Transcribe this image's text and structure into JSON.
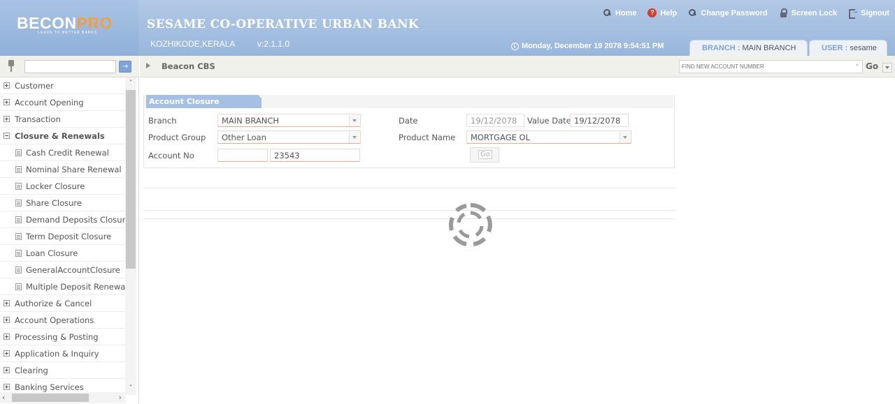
{
  "header": {
    "logo_text_a": "BE",
    "logo_text_b": "CON",
    "logo_text_c": "PRO",
    "logo_tagline": "LEADS TO BETTER BANKS",
    "bank_name": "SESAME CO-OPERATIVE URBAN BANK",
    "location": "KOZHIKODE,KERALA",
    "version": "v:2.1.1.0",
    "links": {
      "home": "Home",
      "help": "Help",
      "change_password": "Change Password",
      "screen_lock": "Screen Lock",
      "signout": "Signout"
    },
    "datetime": "Monday, December 19 2078 9:54:51 PM",
    "branch_key": "BRANCH :",
    "branch_value": "MAIN BRANCH",
    "user_key": "USER :",
    "user_value": "sesame"
  },
  "sidebar": {
    "search_value": "",
    "go_glyph": "→",
    "menu": [
      {
        "label": "Customer",
        "type": "collapsed"
      },
      {
        "label": "Account Opening",
        "type": "collapsed"
      },
      {
        "label": "Transaction",
        "type": "collapsed"
      },
      {
        "label": "Closure & Renewals",
        "type": "expanded"
      },
      {
        "label": "Cash Credit Renewal",
        "type": "child"
      },
      {
        "label": "Nominal Share Renewal",
        "type": "child"
      },
      {
        "label": "Locker Closure",
        "type": "child"
      },
      {
        "label": "Share Closure",
        "type": "child"
      },
      {
        "label": "Demand Deposits Closure",
        "type": "child"
      },
      {
        "label": "Term Deposit Closure",
        "type": "child"
      },
      {
        "label": "Loan Closure",
        "type": "child"
      },
      {
        "label": "GeneralAccountClosure",
        "type": "child"
      },
      {
        "label": "Multiple Deposit Renewal",
        "type": "child"
      },
      {
        "label": "Authorize & Cancel",
        "type": "collapsed"
      },
      {
        "label": "Account Operations",
        "type": "collapsed"
      },
      {
        "label": "Processing & Posting",
        "type": "collapsed"
      },
      {
        "label": "Application & Inquiry",
        "type": "collapsed"
      },
      {
        "label": "Clearing",
        "type": "collapsed"
      },
      {
        "label": "Banking Services",
        "type": "collapsed"
      }
    ],
    "scroll_up": "˄",
    "scroll_down": "˅",
    "scroll_left": "‹",
    "scroll_right": "›"
  },
  "main": {
    "breadcrumb": "Beacon CBS",
    "account_search_placeholder": "FIND NEW ACCOUNT NUMBER",
    "account_search_go": "Go",
    "panel_title": "Account Closure",
    "form": {
      "branch_label": "Branch",
      "branch_value": "MAIN BRANCH",
      "date_label": "Date",
      "date_value": "19/12/2078",
      "value_date_label": "Value Date",
      "value_date_value": "19/12/2078",
      "product_group_label": "Product Group",
      "product_group_value": "Other Loan",
      "product_name_label": "Product Name",
      "product_name_value": "MORTGAGE OL",
      "account_no_label": "Account No",
      "account_prefix_value": "",
      "account_no_value": "23543",
      "go_label": "Go"
    },
    "loading": true
  },
  "colors": {
    "header_bg": "#a6c1e3",
    "accent_blue": "#7ea3d4",
    "logo_orange": "#f0a040",
    "panel_title_bg": "#a5c0e2",
    "field_underline": "#f0a890",
    "spinner_gray": "#9a9a9a"
  }
}
